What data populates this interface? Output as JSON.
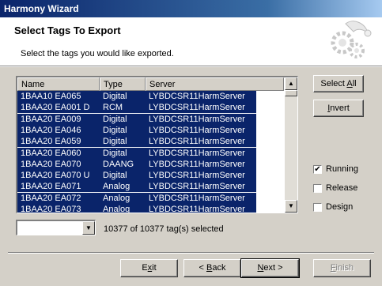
{
  "window": {
    "title": "Harmony Wizard"
  },
  "header": {
    "title": "Select Tags To Export",
    "subtitle": "Select the tags you would like exported.",
    "icon": "wizard-hat-gears-icon"
  },
  "list": {
    "columns": [
      "Name",
      "Type",
      "Server"
    ],
    "rows": [
      [
        "1BAA10 EA065",
        "Digital",
        "LYBDCSR11HarmServer"
      ],
      [
        "1BAA20 EA001 D",
        "RCM",
        "LYBDCSR11HarmServer"
      ],
      [
        "1BAA20 EA009",
        "Digital",
        "LYBDCSR11HarmServer"
      ],
      [
        "1BAA20 EA046",
        "Digital",
        "LYBDCSR11HarmServer"
      ],
      [
        "1BAA20 EA059",
        "Digital",
        "LYBDCSR11HarmServer"
      ],
      [
        "1BAA20 EA060",
        "Digital",
        "LYBDCSR11HarmServer"
      ],
      [
        "1BAA20 EA070",
        "DAANG",
        "LYBDCSR11HarmServer"
      ],
      [
        "1BAA20 EA070 U",
        "Digital",
        "LYBDCSR11HarmServer"
      ],
      [
        "1BAA20 EA071",
        "Analog",
        "LYBDCSR11HarmServer"
      ],
      [
        "1BAA20 EA072",
        "Analog",
        "LYBDCSR11HarmServer"
      ],
      [
        "1BAA20 EA073",
        "Analog",
        "LYBDCSR11HarmServer"
      ]
    ]
  },
  "buttons": {
    "select_all_pre": "Select ",
    "select_all_ul": "A",
    "select_all_post": "ll",
    "invert_pre": "",
    "invert_ul": "I",
    "invert_post": "nvert",
    "exit_pre": "E",
    "exit_ul": "x",
    "exit_post": "it",
    "back_pre": "< ",
    "back_ul": "B",
    "back_post": "ack",
    "next_pre": "",
    "next_ul": "N",
    "next_post": "ext >",
    "finish_pre": "",
    "finish_ul": "F",
    "finish_post": "inish"
  },
  "options": [
    {
      "label": "Running",
      "checked": true
    },
    {
      "label": "Release",
      "checked": false
    },
    {
      "label": "Design",
      "checked": false
    }
  ],
  "combo": {
    "value": ""
  },
  "status": "10377 of 10377 tag(s) selected",
  "colors": {
    "selection": "#0a246a",
    "face": "#d4d0c8"
  }
}
